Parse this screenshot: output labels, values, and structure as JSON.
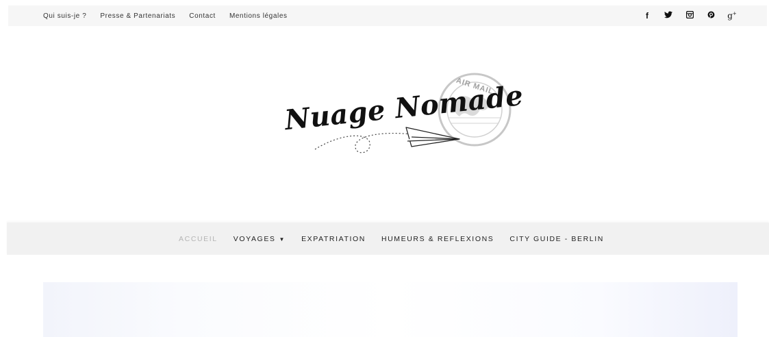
{
  "topbar": {
    "links": [
      "Qui suis-je ?",
      "Presse & Partenariats",
      "Contact",
      "Mentions légales"
    ],
    "social_icons": [
      "facebook-icon",
      "twitter-icon",
      "instagram-icon",
      "pinterest-icon",
      "google-plus-icon"
    ]
  },
  "logo": {
    "title": "Nuage Nomade",
    "stamp_text": "AIR MAIL"
  },
  "nav": {
    "items": [
      {
        "label": "ACCUEIL",
        "active": true
      },
      {
        "label": "VOYAGES",
        "has_dropdown": true
      },
      {
        "label": "EXPATRIATION"
      },
      {
        "label": "HUMEURS & REFLEXIONS"
      },
      {
        "label": "CITY GUIDE - BERLIN"
      }
    ],
    "active_color": "#b4b4b4"
  },
  "colors": {
    "topbar_bg": "#f6f6f6",
    "nav_bg": "#f1f1f1",
    "text": "#222222"
  }
}
